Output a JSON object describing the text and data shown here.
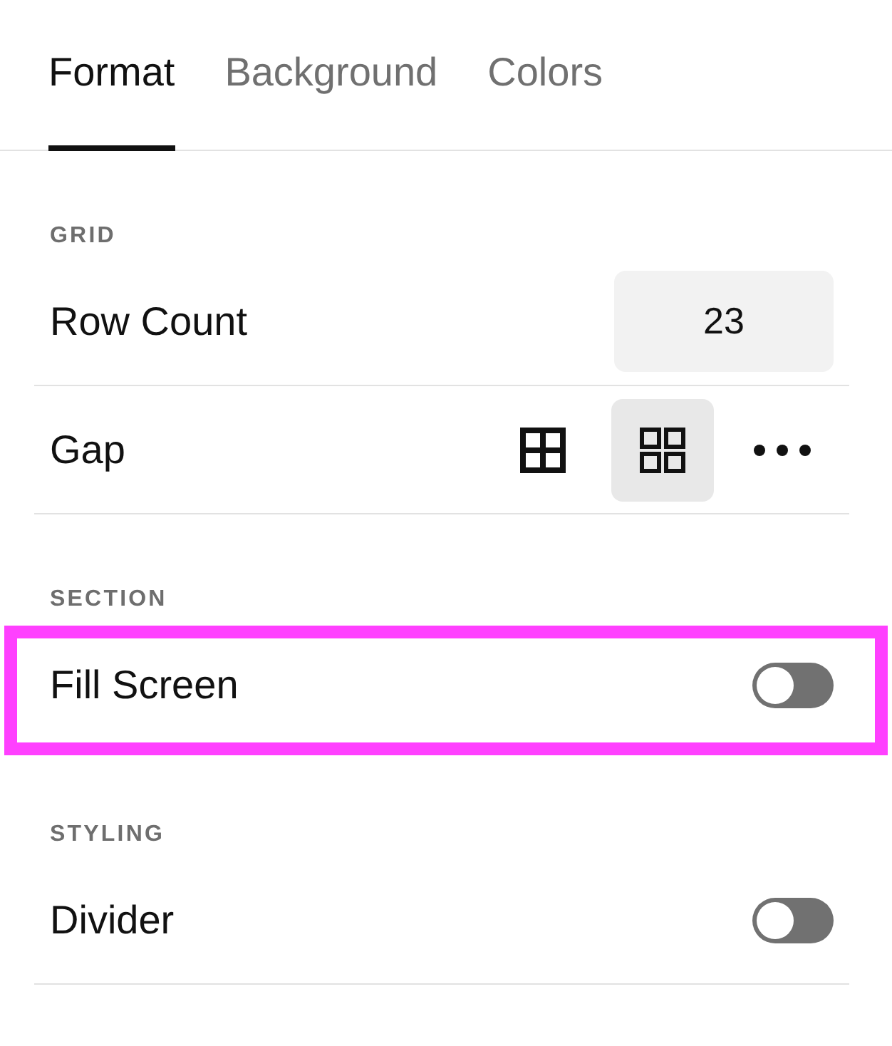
{
  "tabs": [
    {
      "label": "Format",
      "selected": true
    },
    {
      "label": "Background",
      "selected": false
    },
    {
      "label": "Colors",
      "selected": false
    }
  ],
  "sections": [
    {
      "heading": "GRID",
      "rows": [
        {
          "kind": "number",
          "label": "Row Count",
          "value": "23"
        },
        {
          "kind": "options",
          "label": "Gap",
          "options": [
            {
              "kind": "tight",
              "selected": false
            },
            {
              "kind": "spaced",
              "selected": true
            },
            {
              "kind": "more",
              "selected": false
            }
          ]
        }
      ]
    },
    {
      "heading": "SECTION",
      "rows": [
        {
          "kind": "toggle",
          "label": "Fill Screen",
          "on": false,
          "highlighted": true
        }
      ]
    },
    {
      "heading": "STYLING",
      "rows": [
        {
          "kind": "toggle",
          "label": "Divider",
          "on": false,
          "highlighted": false
        }
      ]
    }
  ]
}
